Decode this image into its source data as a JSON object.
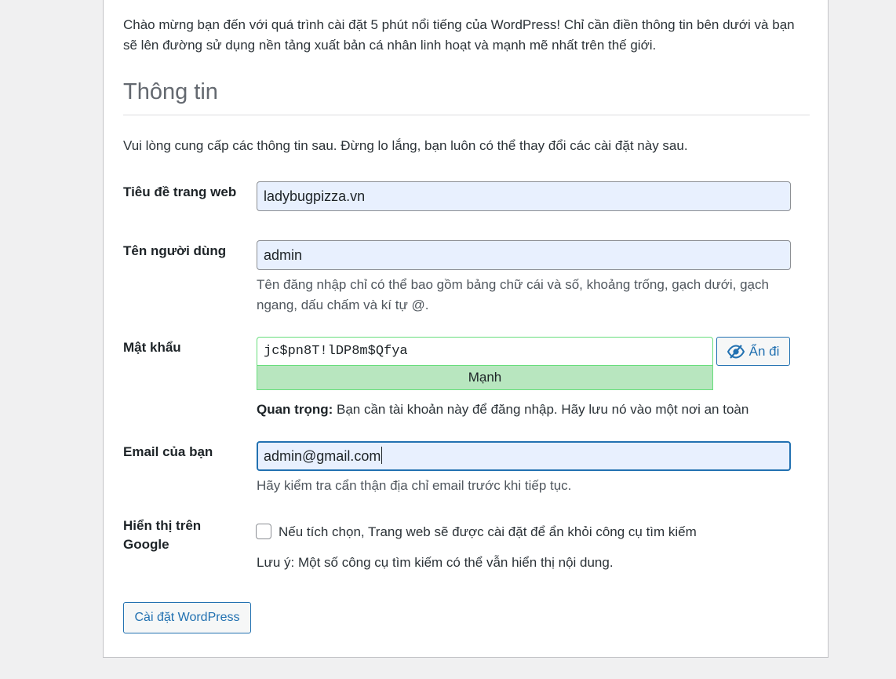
{
  "intro": "Chào mừng bạn đến với quá trình cài đặt 5 phút nổi tiếng của WordPress! Chỉ cần điền thông tin bên dưới và bạn sẽ lên đường sử dụng nền tảng xuất bản cá nhân linh hoạt và mạnh mẽ nhất trên thế giới.",
  "section_title": "Thông tin",
  "subtitle": "Vui lòng cung cấp các thông tin sau. Đừng lo lắng, bạn luôn có thể thay đổi các cài đặt này sau.",
  "site_title": {
    "label": "Tiêu đề trang web",
    "value": "ladybugpizza.vn"
  },
  "username": {
    "label": "Tên người dùng",
    "value": "admin",
    "hint": "Tên đăng nhập chỉ có thể bao gồm bảng chữ cái và số, khoảng trống, gạch dưới, gạch ngang, dấu chấm và kí tự @."
  },
  "password": {
    "label": "Mật khẩu",
    "value": "jc$pn8T!lDP8m$Qfya",
    "strength": "Mạnh",
    "hide_button": "Ẩn đi",
    "hide_icon": "eye-slash-icon",
    "important_label": "Quan trọng:",
    "important_text": " Bạn cần tài khoản này để đăng nhập. Hãy lưu nó vào một nơi an toàn",
    "strength_color": "#b8e6bf"
  },
  "email": {
    "label": "Email của bạn",
    "value": "admin@gmail.com",
    "hint": "Hãy kiểm tra cẩn thận địa chỉ email trước khi tiếp tục."
  },
  "visibility": {
    "label": "Hiển thị trên Google",
    "checkbox_label": "Nếu tích chọn, Trang web sẽ được cài đặt để ẩn khỏi công cụ tìm kiếm",
    "checked": false,
    "note": "Lưu ý: Một số công cụ tìm kiếm có thể vẫn hiển thị nội dung."
  },
  "install_button": "Cài đặt WordPress",
  "colors": {
    "accent": "#2271b1",
    "autofill_bg": "#e8f0fe",
    "strong_border": "#68de7c"
  }
}
